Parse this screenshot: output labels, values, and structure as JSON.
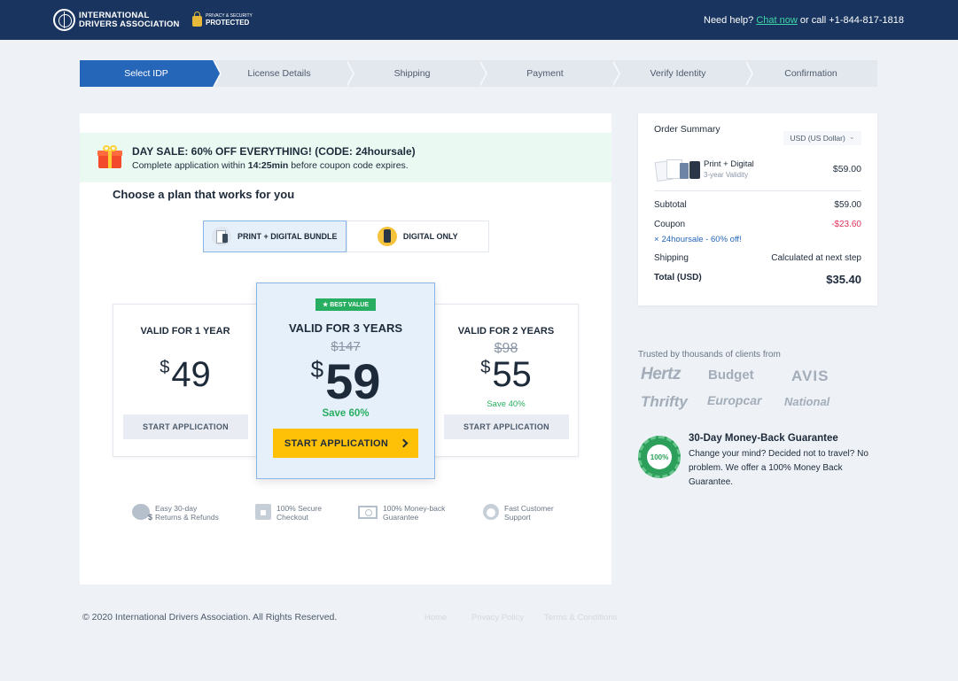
{
  "header": {
    "logo_line1": "INTERNATIONAL",
    "logo_line2": "DRIVERS ASSOCIATION",
    "privacy_small": "PRIVACY & SECURITY",
    "privacy_big": "PROTECTED",
    "help_prefix": "Need help?",
    "chat_link": "Chat now",
    "help_suffix": "or call +1-844-817-1818"
  },
  "steps": [
    {
      "label": "Select IDP",
      "active": true
    },
    {
      "label": "License Details"
    },
    {
      "label": "Shipping"
    },
    {
      "label": "Payment"
    },
    {
      "label": "Verify Identity"
    },
    {
      "label": "Confirmation"
    }
  ],
  "promo": {
    "title": "DAY SALE: 60% OFF EVERYTHING! (CODE: 24hoursale)",
    "sub_prefix": "Complete application within",
    "timer": "14:25min",
    "sub_suffix": "before coupon code expires."
  },
  "choose_title": "Choose a plan that works for you",
  "plan_toggle": {
    "bundle": "PRINT + DIGITAL BUNDLE",
    "digital": "DIGITAL ONLY"
  },
  "cards": {
    "left": {
      "term": "VALID FOR 1 YEAR",
      "currency": "$",
      "price": "49",
      "button": "START APPLICATION"
    },
    "middle": {
      "badge": "★ BEST VALUE",
      "term": "VALID FOR 3 YEARS",
      "old_price": "$147",
      "currency": "$",
      "price": "59",
      "save": "Save 60%",
      "button": "START APPLICATION"
    },
    "right": {
      "term": "VALID FOR 2 YEARS",
      "old_price": "$98",
      "currency": "$",
      "price": "55",
      "save": "Save 40%",
      "button": "START APPLICATION"
    }
  },
  "features": [
    {
      "line1": "Easy 30-day",
      "line2": "Returns & Refunds"
    },
    {
      "line1": "100% Secure",
      "line2": "Checkout"
    },
    {
      "line1": "100% Money-back",
      "line2": "Guarantee"
    },
    {
      "line1": "Fast Customer",
      "line2": "Support"
    }
  ],
  "summary": {
    "title": "Order Summary",
    "currency": "USD (US Dollar)",
    "product_name": "Print + Digital",
    "product_sub": "3-year Validity",
    "product_price": "$59.00",
    "subtotal_label": "Subtotal",
    "subtotal": "$59.00",
    "coupon_label": "Coupon",
    "coupon_value": "-$23.60",
    "coupon_remove": "×",
    "coupon_code": "24hoursale - 60% off!",
    "shipping_label": "Shipping",
    "shipping_value": "Calculated at next step",
    "total_label": "Total (USD)",
    "total": "$35.40"
  },
  "trusted": {
    "title": "Trusted by thousands of clients from",
    "brands": [
      "Hertz",
      "Budget",
      "AVIS",
      "Thrifty",
      "Europcar",
      "National"
    ]
  },
  "guarantee": {
    "seal": "100%",
    "title": "30-Day Money-Back Guarantee",
    "text": "Change your mind? Decided not to travel? No problem. We offer a 100% Money Back Guarantee."
  },
  "footer": {
    "copyright": "© 2020 International Drivers Association. All Rights Reserved.",
    "links": [
      "Home",
      "Privacy Policy",
      "Terms & Conditions"
    ]
  },
  "colors": {
    "header": "#19355f",
    "active_step": "#2566b8",
    "cta": "#ffc107",
    "save_green": "#27ae60",
    "coupon_red": "#e0305a",
    "chat_link": "#3ed6a6"
  }
}
